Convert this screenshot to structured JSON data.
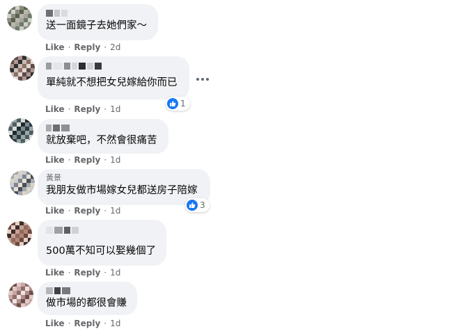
{
  "actions": {
    "like_label": "Like",
    "reply_label": "Reply",
    "separator": "·"
  },
  "colors": {
    "bubble": "#f0f2f5",
    "action_text": "#65676b",
    "like_blue": "#1877f2"
  },
  "comments": [
    {
      "name_visible": "",
      "text": "送一面鏡子去她們家～",
      "timestamp": "2d",
      "reaction_count": "",
      "avatar_palette": [
        "#a7a69a",
        "#6e7a6a",
        "#cfd0c8",
        "#8a8c7e",
        "#58624f",
        "#b9b7ae"
      ]
    },
    {
      "name_visible": "",
      "text": "單純就不想把女兒嫁給你而已",
      "timestamp": "1d",
      "reaction_count": "1",
      "reaction_icon": "like-icon",
      "avatar_palette": [
        "#2e2f33",
        "#c9b9b1",
        "#8b6f68",
        "#e3d6d0",
        "#5a4c49",
        "#b09690"
      ]
    },
    {
      "name_visible": "",
      "text": "就放棄吧，不然會很痛苦",
      "timestamp": "1d",
      "reaction_count": "",
      "avatar_palette": [
        "#2d3a42",
        "#9aa7a8",
        "#4e5e63",
        "#d9dcd6",
        "#1e2a30",
        "#7c8a8c"
      ]
    },
    {
      "name_visible": "黃景",
      "text": "我朋友做市場嫁女兒都送房子陪嫁",
      "timestamp": "1d",
      "reaction_count": "3",
      "reaction_icon": "like-icon",
      "avatar_palette": [
        "#c9cdd2",
        "#7f8690",
        "#e7e0d6",
        "#4b4f56",
        "#a3a9b1",
        "#dcd3c5"
      ]
    },
    {
      "name_visible": "",
      "text": "500萬不知可以娶幾個了",
      "timestamp": "1d",
      "reaction_count": "",
      "avatar_palette": [
        "#b28576",
        "#6b4a41",
        "#e6cfc3",
        "#3d2c27",
        "#c7a294",
        "#8f6a5e"
      ]
    },
    {
      "name_visible": "",
      "text": "做市場的都很會賺",
      "timestamp": "1d",
      "reaction_count": "",
      "avatar_palette": [
        "#c9a7a3",
        "#8f6e6b",
        "#efe4e2",
        "#b18c88",
        "#6d4f4c",
        "#e0c9c6"
      ]
    }
  ]
}
